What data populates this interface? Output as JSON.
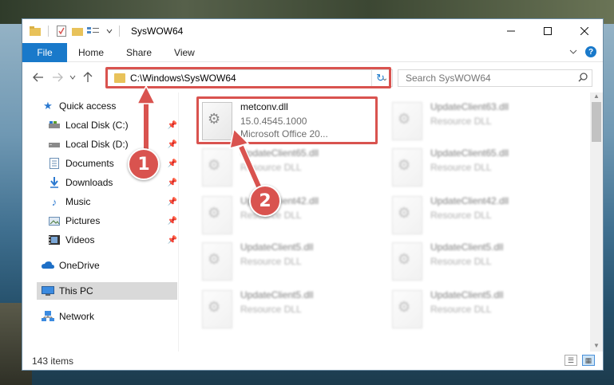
{
  "window": {
    "title": "SysWOW64",
    "controls": [
      "minimize-icon",
      "maximize-icon",
      "close-icon"
    ]
  },
  "ribbon": {
    "file_label": "File",
    "tabs": [
      "Home",
      "Share",
      "View"
    ],
    "help_label": "?"
  },
  "navigation": {
    "address": "C:\\Windows\\SysWOW64",
    "search_placeholder": "Search SysWOW64"
  },
  "sidebar": {
    "items": [
      {
        "label": "Quick access",
        "icon": "star-icon",
        "pinned": false
      },
      {
        "label": "Local Disk (C:)",
        "icon": "drive-icon",
        "pinned": true
      },
      {
        "label": "Local Disk (D:)",
        "icon": "drive-icon",
        "pinned": true
      },
      {
        "label": "Documents",
        "icon": "documents-icon",
        "pinned": true
      },
      {
        "label": "Downloads",
        "icon": "download-icon",
        "pinned": true
      },
      {
        "label": "Music",
        "icon": "music-icon",
        "pinned": true
      },
      {
        "label": "Pictures",
        "icon": "pictures-icon",
        "pinned": true
      },
      {
        "label": "Videos",
        "icon": "videos-icon",
        "pinned": true
      },
      {
        "label": "OneDrive",
        "icon": "cloud-icon",
        "pinned": false
      },
      {
        "label": "This PC",
        "icon": "computer-icon",
        "pinned": false,
        "selected": true
      },
      {
        "label": "Network",
        "icon": "network-icon",
        "pinned": false
      }
    ]
  },
  "files": [
    {
      "name": "metconv.dll",
      "line2": "15.0.4545.1000",
      "line3": "Microsoft Office 20...",
      "highlighted": true
    },
    {
      "name": "UpdateClient63.dll",
      "line2": "Resource DLL"
    },
    {
      "name": "UpdateClient65.dll",
      "line2": "Resource DLL"
    },
    {
      "name": "UpdateClient65.dll",
      "line2": "Resource DLL"
    },
    {
      "name": "UpdateClient42.dll",
      "line2": "Resource DLL"
    },
    {
      "name": "UpdateClient42.dll",
      "line2": "Resource DLL"
    },
    {
      "name": "UpdateClient5.dll",
      "line2": "Resource DLL"
    },
    {
      "name": "UpdateClient5.dll",
      "line2": "Resource DLL"
    },
    {
      "name": "UpdateClient5.dll",
      "line2": "Resource DLL"
    },
    {
      "name": "UpdateClient5.dll",
      "line2": "Resource DLL"
    }
  ],
  "status": {
    "item_count": "143 items"
  },
  "callouts": {
    "one": "1",
    "two": "2"
  },
  "colors": {
    "accent": "#1979ca",
    "callout": "#d9534f",
    "selection": "#d9d9d9"
  }
}
